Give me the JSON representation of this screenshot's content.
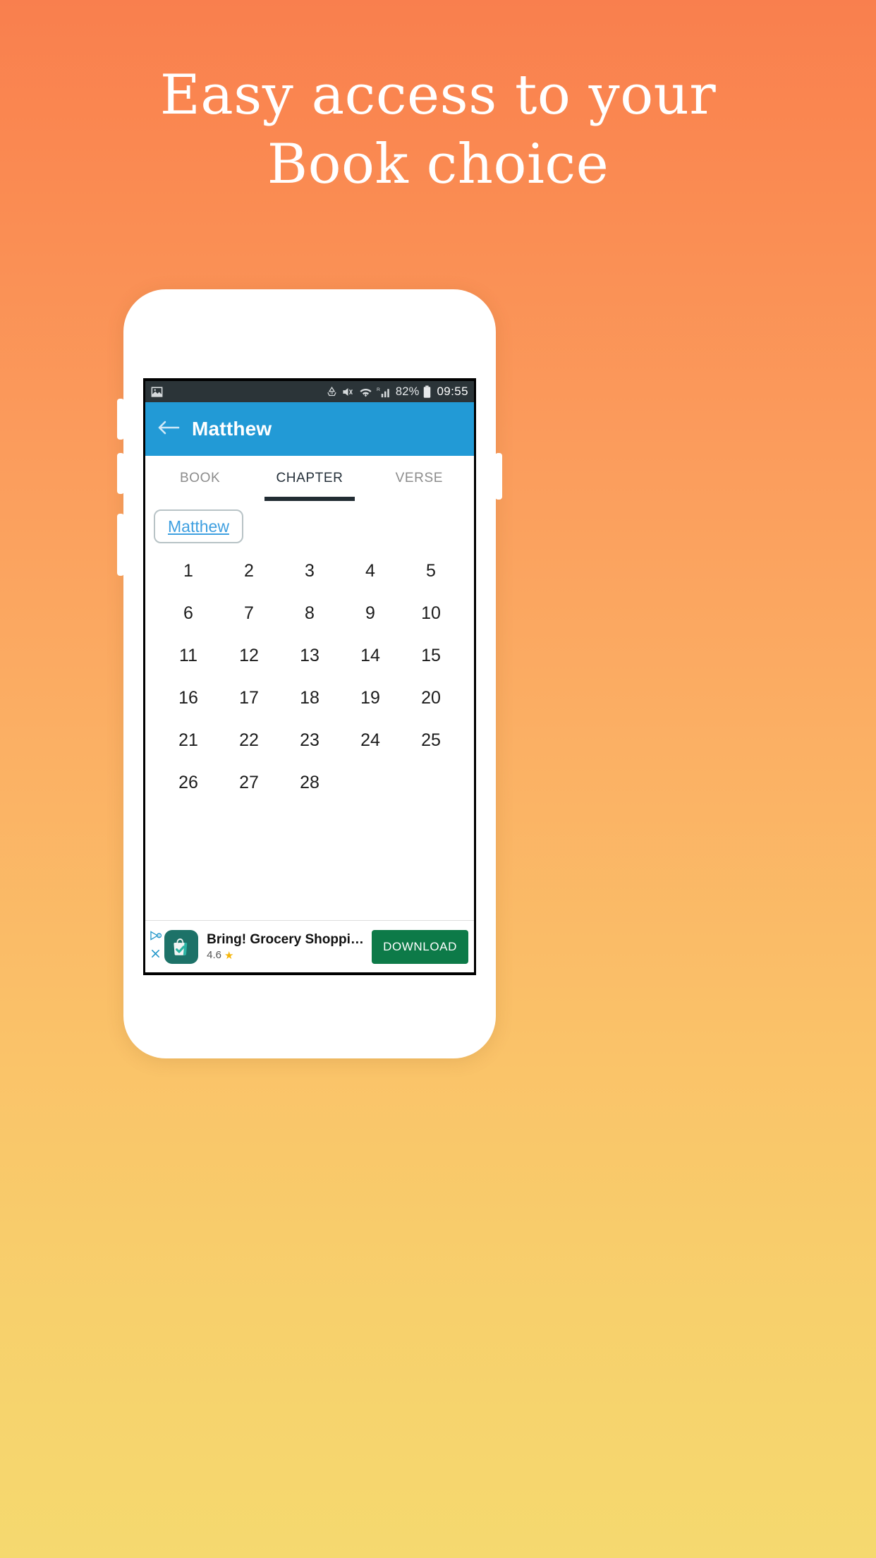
{
  "promo": {
    "line1": "Easy access to your",
    "line2": "Book choice",
    "background_top": "#f97f4e",
    "background_bottom": "#f5d96f",
    "text_color": "#ffffff"
  },
  "phone": {
    "status_bar": {
      "background": "#2b3438",
      "left_icons": [
        "image-icon"
      ],
      "right_icons": [
        "data-transfer-icon",
        "volume-mute-icon",
        "wifi-icon",
        "cell-signal-roaming-icon"
      ],
      "battery_percent": "82%",
      "battery_icon": "battery-full-icon",
      "clock": "09:55"
    },
    "appbar": {
      "back_icon": "arrow-left-icon",
      "title": "Matthew",
      "color": "#229ad6"
    },
    "tabs": [
      {
        "label": "BOOK",
        "active": false
      },
      {
        "label": "CHAPTER",
        "active": true
      },
      {
        "label": "VERSE",
        "active": false
      }
    ],
    "book_chip": {
      "label": "Matthew",
      "link_color": "#3e9fe0"
    },
    "chapters": [
      "1",
      "2",
      "3",
      "4",
      "5",
      "6",
      "7",
      "8",
      "9",
      "10",
      "11",
      "12",
      "13",
      "14",
      "15",
      "16",
      "17",
      "18",
      "19",
      "20",
      "21",
      "22",
      "23",
      "24",
      "25",
      "26",
      "27",
      "28"
    ],
    "ad": {
      "adchoices_icon": "adchoices-icon",
      "close_icon": "close-icon",
      "app_icon": "shopping-bag-check-icon",
      "app_icon_color": "#1d7268",
      "title": "Bring! Grocery Shopping List",
      "rating": "4.6",
      "star_icon": "star-icon",
      "cta_label": "DOWNLOAD",
      "cta_color": "#0d7a48"
    }
  }
}
